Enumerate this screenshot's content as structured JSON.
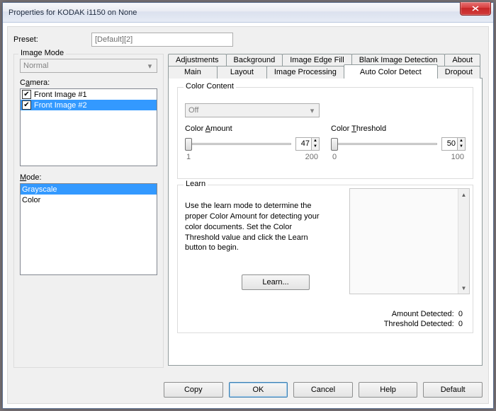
{
  "window": {
    "title": "Properties for KODAK i1150 on None"
  },
  "preset": {
    "label": "Preset:",
    "value": "[Default][2]"
  },
  "image_mode": {
    "legend": "Image Mode",
    "combo_value": "Normal",
    "camera_label": "Camera:",
    "camera_items": [
      "Front Image #1",
      "Front Image #2"
    ],
    "mode_label": "Mode:",
    "mode_items": [
      "Grayscale",
      "Color"
    ]
  },
  "tabs_top": [
    "Adjustments",
    "Background",
    "Image Edge Fill",
    "Blank Image Detection",
    "About"
  ],
  "tabs_bottom": [
    "Main",
    "Layout",
    "Image Processing",
    "Auto Color Detect",
    "Dropout"
  ],
  "color_content": {
    "legend": "Color Content",
    "combo_value": "Off",
    "amount_label": "Color Amount",
    "amount_underline": "A",
    "amount_value": "47",
    "amount_min": "1",
    "amount_max": "200",
    "threshold_label": "Color Threshold",
    "threshold_underline": "T",
    "threshold_value": "50",
    "threshold_min": "0",
    "threshold_max": "100"
  },
  "learn": {
    "legend": "Learn",
    "text": "Use the learn mode to determine the proper Color Amount for detecting your color documents. Set the Color Threshold value and click the Learn button to begin.",
    "button": "Learn...",
    "amount_detected_label": "Amount Detected:",
    "amount_detected_value": "0",
    "threshold_detected_label": "Threshold Detected:",
    "threshold_detected_value": "0"
  },
  "buttons": {
    "copy": "Copy",
    "ok": "OK",
    "cancel": "Cancel",
    "help": "Help",
    "default": "Default"
  }
}
